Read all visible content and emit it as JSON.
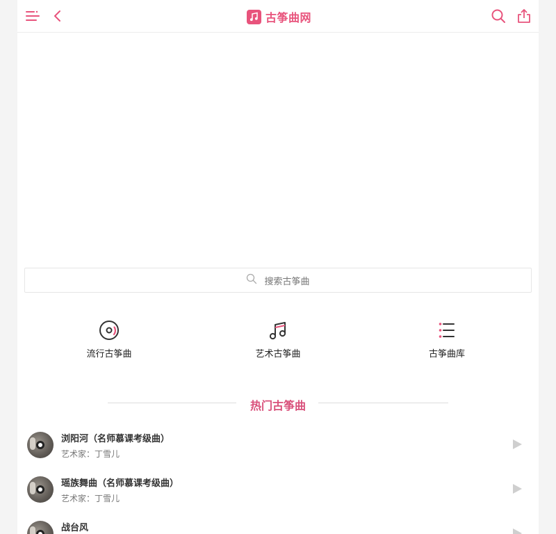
{
  "header": {
    "title": "古筝曲网",
    "menu_icon": "menu-icon",
    "back_icon": "back-icon",
    "search_icon": "search-icon",
    "share_icon": "share-icon",
    "accent": "#e8537c"
  },
  "search": {
    "placeholder": "搜索古筝曲"
  },
  "categories": [
    {
      "label": "流行古筝曲",
      "icon": "disc-icon"
    },
    {
      "label": "艺术古筝曲",
      "icon": "music-note-icon"
    },
    {
      "label": "古筝曲库",
      "icon": "list-icon"
    }
  ],
  "section": {
    "title": "热门古筝曲"
  },
  "songs": [
    {
      "title": "浏阳河（名师慕课考级曲）",
      "artist": "艺术家：丁雪儿"
    },
    {
      "title": "瑶族舞曲（名师慕课考级曲）",
      "artist": "艺术家：丁雪儿"
    },
    {
      "title": "战台风",
      "artist": ""
    }
  ]
}
